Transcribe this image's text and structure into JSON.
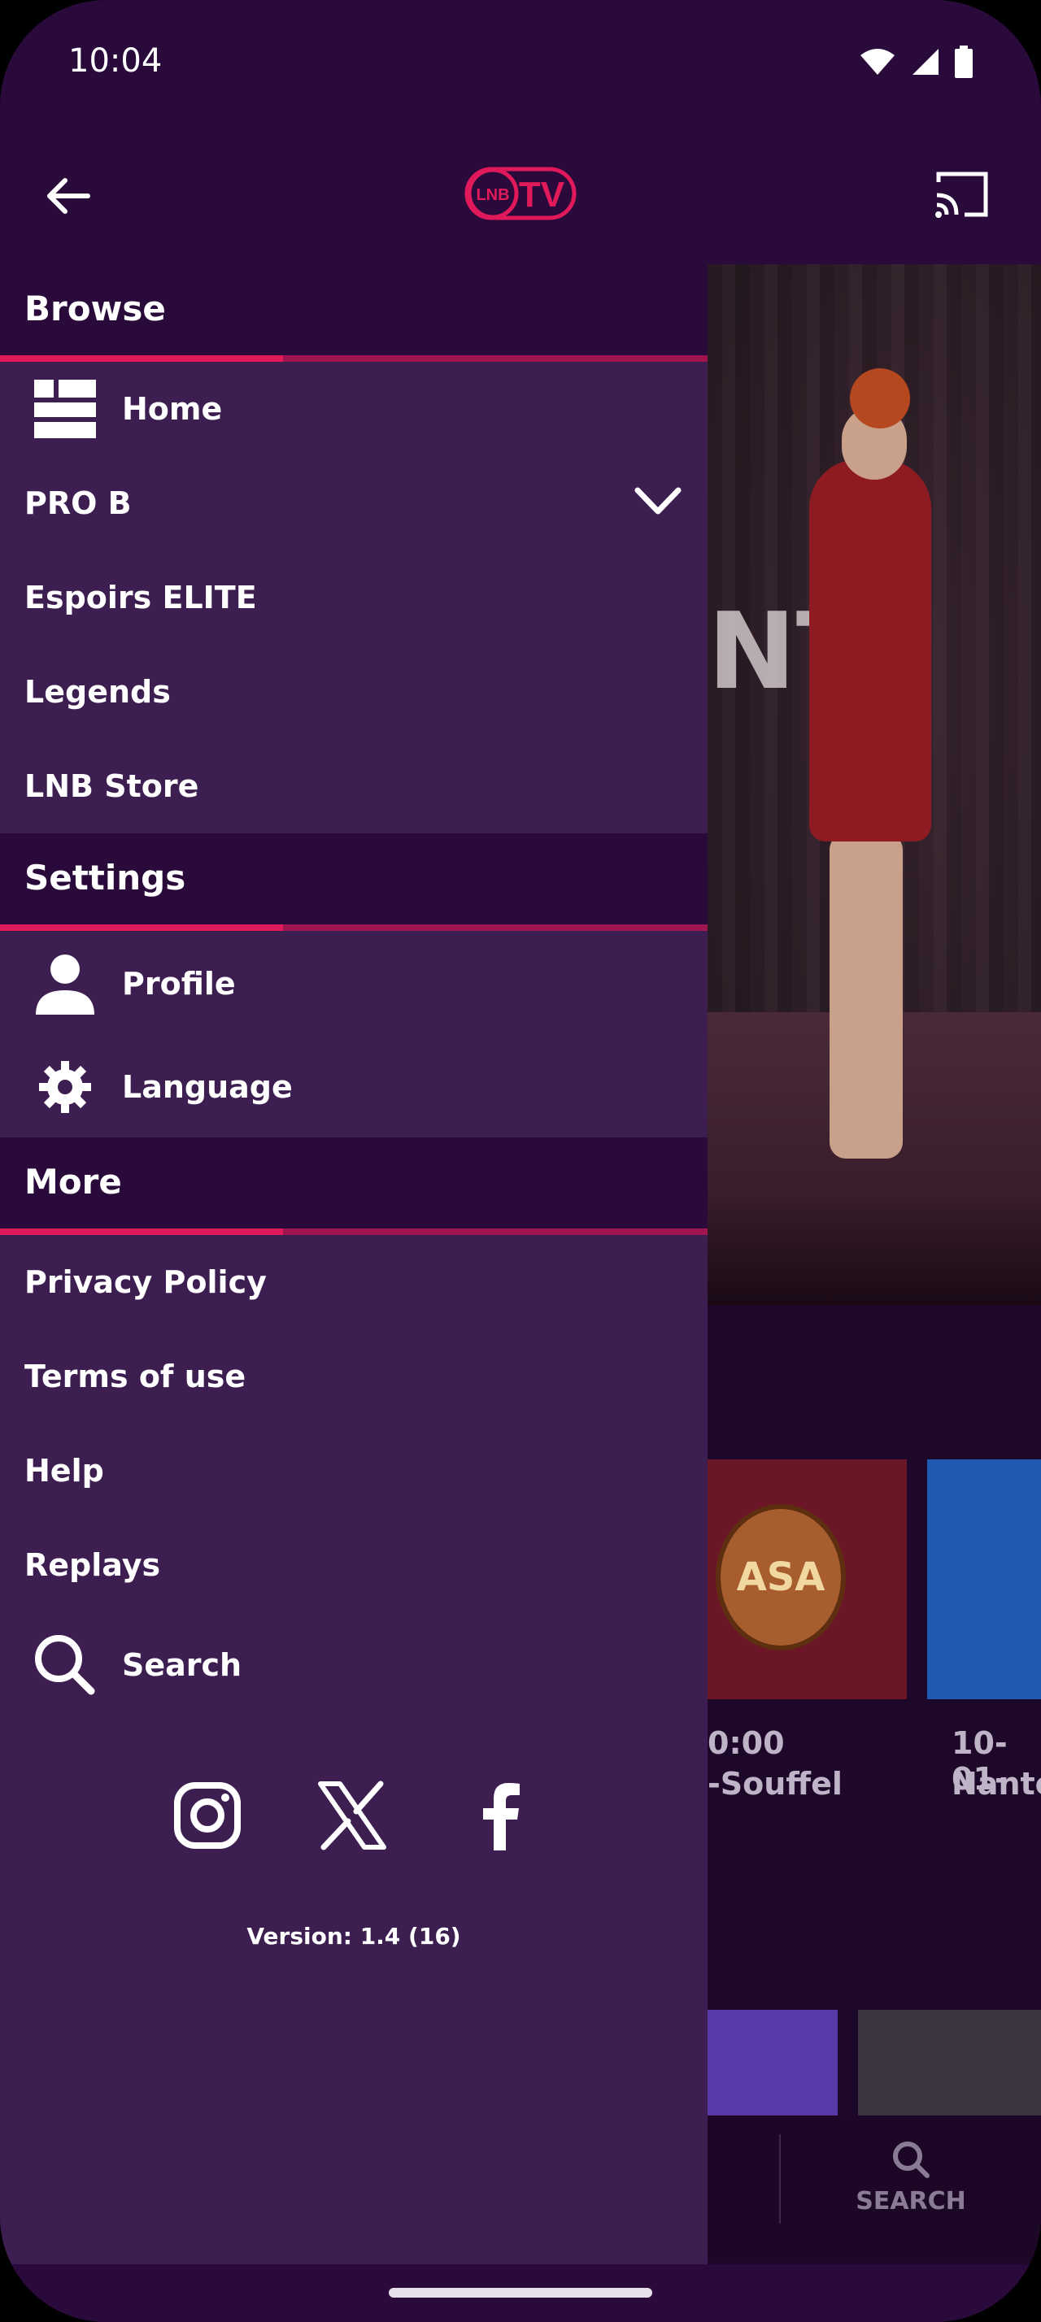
{
  "status_bar": {
    "time": "10:04",
    "icons": [
      "wifi-icon",
      "signal-icon",
      "battery-icon"
    ]
  },
  "app_bar": {
    "logo_text": "TV",
    "logo_badge": "LNB",
    "icons": [
      "back-arrow-icon",
      "cast-icon"
    ]
  },
  "drawer": {
    "sections": {
      "browse": {
        "title": "Browse",
        "items": [
          {
            "label": "Home",
            "icon": "home-grid-icon"
          },
          {
            "label": "PRO B",
            "icon": "chevron-down-icon"
          },
          {
            "label": "Espoirs ELITE"
          },
          {
            "label": "Legends"
          },
          {
            "label": "LNB Store"
          }
        ]
      },
      "settings": {
        "title": "Settings",
        "items": [
          {
            "label": "Profile",
            "icon": "person-icon"
          },
          {
            "label": "Language",
            "icon": "gear-icon"
          }
        ]
      },
      "more": {
        "title": "More",
        "items": [
          {
            "label": "Privacy Policy"
          },
          {
            "label": "Terms of use"
          },
          {
            "label": "Help"
          },
          {
            "label": "Replays"
          },
          {
            "label": "Search",
            "icon": "search-icon"
          }
        ]
      }
    },
    "social": [
      "instagram-icon",
      "x-icon",
      "facebook-icon"
    ],
    "version": "Version: 1.4 (16)"
  },
  "background": {
    "hero_letters": "NT",
    "card1_time": "0:00",
    "card1_team": "-Souffel",
    "card2_time": "10-01-",
    "card2_team": "Nante",
    "card1_logo": "ASA",
    "nav_search_label": "SEARCH"
  },
  "colors": {
    "primary_bg": "#2a0a3b",
    "drawer_bg": "#3d1e51",
    "accent": "#e0195a"
  }
}
